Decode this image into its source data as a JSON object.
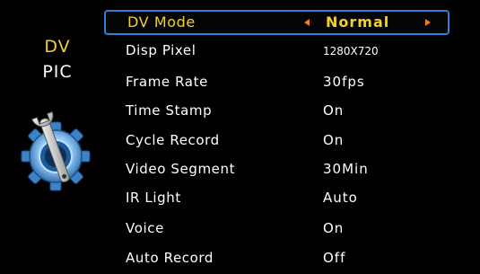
{
  "tabs": {
    "dv": "DV",
    "pic": "PIC"
  },
  "icons": {
    "settings": "settings-gear-wrench-icon",
    "prev": "triangle-left-icon",
    "next": "triangle-right-icon"
  },
  "colors": {
    "accent": "#f2d028",
    "selection_border": "#2f80d8",
    "arrow": "#f27e1c",
    "text": "#ffffff",
    "background": "#000000"
  },
  "menu": {
    "items": [
      {
        "label": "DV Mode",
        "value": "Normal",
        "selected": true
      },
      {
        "label": "Disp Pixel",
        "value": "1280X720"
      },
      {
        "label": "Frame Rate",
        "value": "30fps"
      },
      {
        "label": "Time Stamp",
        "value": "On"
      },
      {
        "label": "Cycle Record",
        "value": "On"
      },
      {
        "label": "Video Segment",
        "value": "30Min"
      },
      {
        "label": "IR Light",
        "value": "Auto"
      },
      {
        "label": "Voice",
        "value": "On"
      },
      {
        "label": "Auto Record",
        "value": "Off"
      }
    ]
  }
}
